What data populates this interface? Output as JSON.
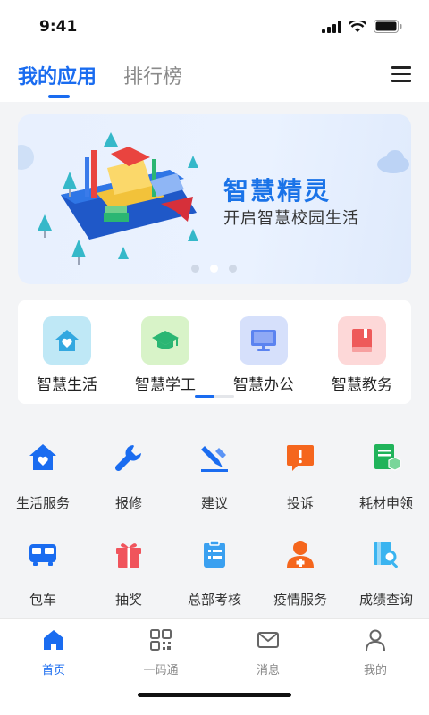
{
  "status": {
    "time": "9:41"
  },
  "nav": {
    "tab_my_apps": "我的应用",
    "tab_ranking": "排行榜"
  },
  "banner": {
    "title": "智慧精灵",
    "subtitle": "开启智慧校园生活"
  },
  "apps": [
    {
      "label": "智慧生活",
      "icon": "home-heart-icon",
      "tile": "#bfe8f6",
      "fg": "#33a8e0"
    },
    {
      "label": "智慧学工",
      "icon": "graduation-cap-icon",
      "tile": "#d8f3c8",
      "fg": "#2bb673"
    },
    {
      "label": "智慧办公",
      "icon": "monitor-icon",
      "tile": "#d6e0fb",
      "fg": "#5b83f0"
    },
    {
      "label": "智慧教务",
      "icon": "book-icon",
      "tile": "#fdd8d8",
      "fg": "#ee5a5a"
    }
  ],
  "services": [
    {
      "label": "生活服务",
      "icon": "house-heart-icon",
      "color": "#1a6cf0"
    },
    {
      "label": "报修",
      "icon": "wrench-icon",
      "color": "#1a6cf0"
    },
    {
      "label": "建议",
      "icon": "pen-icon",
      "color": "#1a6cf0"
    },
    {
      "label": "投诉",
      "icon": "alert-chat-icon",
      "color": "#f5661d"
    },
    {
      "label": "耗材申领",
      "icon": "document-box-icon",
      "color": "#20b35a"
    },
    {
      "label": "包车",
      "icon": "bus-icon",
      "color": "#1a6cf0"
    },
    {
      "label": "抽奖",
      "icon": "gift-icon",
      "color": "#f0545c"
    },
    {
      "label": "总部考核",
      "icon": "clipboard-icon",
      "color": "#3aa0f0"
    },
    {
      "label": "疫情服务",
      "icon": "medical-person-icon",
      "color": "#f5661d"
    },
    {
      "label": "成绩查询",
      "icon": "search-doc-icon",
      "color": "#3ab4f0"
    }
  ],
  "tabbar": [
    {
      "label": "首页",
      "icon": "home-icon",
      "active": true
    },
    {
      "label": "一码通",
      "icon": "qr-code-icon",
      "active": false
    },
    {
      "label": "消息",
      "icon": "mail-icon",
      "active": false
    },
    {
      "label": "我的",
      "icon": "user-icon",
      "active": false
    }
  ],
  "colors": {
    "accent": "#1a6cf0"
  }
}
